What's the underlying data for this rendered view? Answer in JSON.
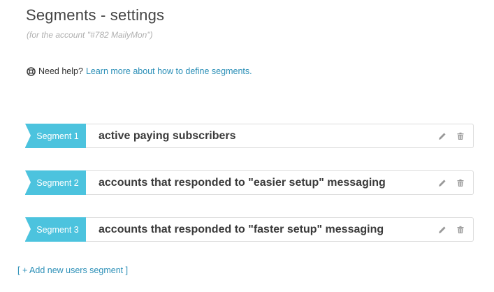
{
  "header": {
    "title": "Segments - settings",
    "subtitle": "(for the account \"#782 MailyMon\")"
  },
  "help": {
    "icon": "lifebuoy-icon",
    "prefix": "Need help?",
    "link_text": "Learn more about how to define segments."
  },
  "segments": [
    {
      "tag": "Segment 1",
      "name": "active paying subscribers"
    },
    {
      "tag": "Segment 2",
      "name": "accounts that responded to \"easier setup\" messaging"
    },
    {
      "tag": "Segment 3",
      "name": "accounts that responded to \"faster setup\" messaging"
    }
  ],
  "add_segment_label": "[ + Add new users segment ]",
  "colors": {
    "tag_bg": "#4cc3de",
    "link": "#2b8fb7",
    "icon": "#999999"
  }
}
